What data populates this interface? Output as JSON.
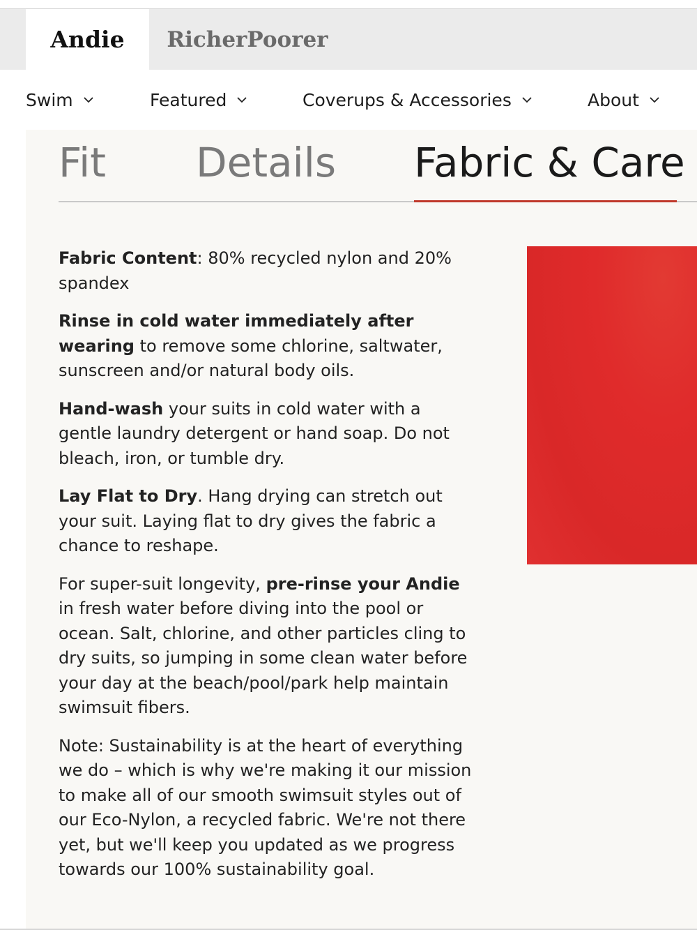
{
  "brands": {
    "primary": "Andie",
    "secondary": "RicherPoorer"
  },
  "nav": {
    "items": [
      {
        "label": "Swim",
        "icon": "chevron-down-icon"
      },
      {
        "label": "Featured",
        "icon": "chevron-down-icon"
      },
      {
        "label": "Coverups & Accessories",
        "icon": "chevron-down-icon"
      },
      {
        "label": "About",
        "icon": "chevron-down-icon"
      }
    ]
  },
  "tabs": {
    "items": [
      {
        "label": "Fit",
        "active": false
      },
      {
        "label": "Details",
        "active": false
      },
      {
        "label": "Fabric & Care",
        "active": true
      }
    ],
    "active_color": "#c0392b"
  },
  "care": {
    "p1_bold": "Fabric Content",
    "p1_text": ": 80% recycled nylon and 20% spandex",
    "p2_bold": "Rinse in cold water immediately after wearing",
    "p2_text": " to remove some chlorine, saltwater, sunscreen and/or natural body oils.",
    "p3_bold": "Hand-wash",
    "p3_text": " your suits in cold water with a gentle laundry detergent or hand soap. Do not bleach, iron, or tumble dry.",
    "p4_bold": "Lay Flat to Dry",
    "p4_text": ". Hang drying can stretch out your suit. Laying flat to dry gives the fabric a chance to reshape.",
    "p5_text_a": "For super-suit longevity, ",
    "p5_bold": "pre-rinse your Andie",
    "p5_text_b": " in fresh water before diving into the pool or ocean. Salt, chlorine, and other particles cling to dry suits, so jumping in some clean water before your day at the beach/pool/park help maintain swimsuit fibers.",
    "p6_text": "Note: Sustainability is at the heart of everything we do – which is why we're making it our mission to make all of our smooth swimsuit styles out of our Eco-Nylon, a recycled fabric. We're not there yet, but we'll keep you updated as we progress towards our 100% sustainability goal."
  },
  "swatch_color": "#e02b2b"
}
